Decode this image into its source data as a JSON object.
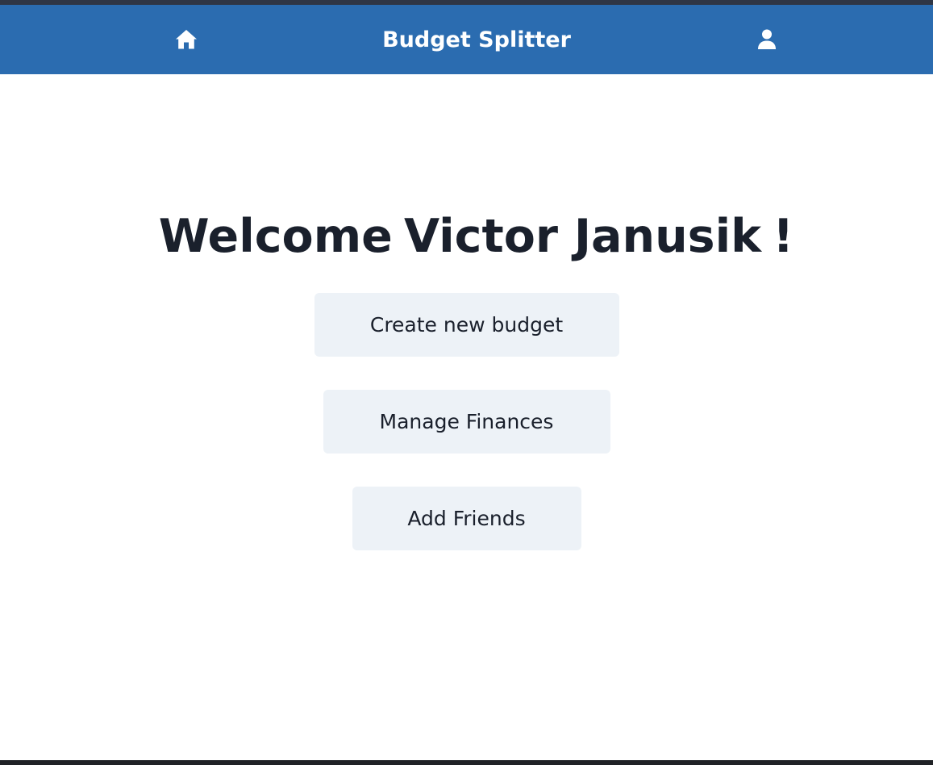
{
  "navbar": {
    "title": "Budget Splitter",
    "home_icon": "home-icon",
    "user_icon": "user-icon",
    "background_color": "#2b6cb0",
    "text_color": "#ffffff"
  },
  "main": {
    "welcome_prefix": "Welcome",
    "user_name": "Victor Janusik",
    "welcome_suffix": "!",
    "buttons": [
      {
        "label": "Create new budget"
      },
      {
        "label": "Manage Finances"
      },
      {
        "label": "Add Friends"
      }
    ],
    "button_background": "#edf2f7",
    "text_color": "#1a202c"
  }
}
